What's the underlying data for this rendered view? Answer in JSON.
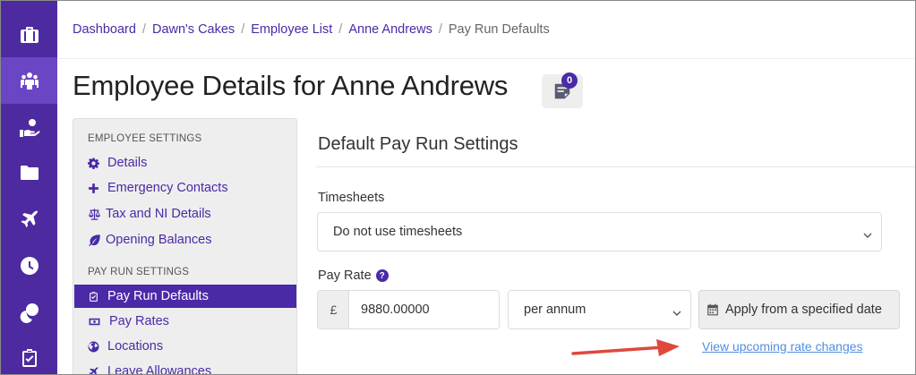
{
  "rail": {
    "items": [
      {
        "icon": "briefcase-icon",
        "active": false
      },
      {
        "icon": "employees-icon",
        "active": true
      },
      {
        "icon": "payments-hand-icon",
        "active": false
      },
      {
        "icon": "folder-icon",
        "active": false
      },
      {
        "icon": "plane-icon",
        "active": false
      },
      {
        "icon": "clock-icon",
        "active": false
      },
      {
        "icon": "coins-icon",
        "active": false
      },
      {
        "icon": "clipboard-check-icon",
        "active": false
      }
    ]
  },
  "breadcrumb": {
    "items": [
      "Dashboard",
      "Dawn's Cakes",
      "Employee List",
      "Anne Andrews"
    ],
    "current": "Pay Run Defaults"
  },
  "page": {
    "title": "Employee Details for Anne Andrews",
    "notes_count": "0"
  },
  "sidemenu": {
    "employee_heading": "EMPLOYEE SETTINGS",
    "employee_items": [
      {
        "label": "Details",
        "icon": "gear-icon"
      },
      {
        "label": "Emergency Contacts",
        "icon": "plus-icon"
      },
      {
        "label": "Tax and NI Details",
        "icon": "balance-scale-icon"
      },
      {
        "label": "Opening Balances",
        "icon": "leaf-icon"
      }
    ],
    "payrun_heading": "PAY RUN SETTINGS",
    "payrun_items": [
      {
        "label": "Pay Run Defaults",
        "icon": "clipboard-list-icon",
        "active": true
      },
      {
        "label": "Pay Rates",
        "icon": "money-bill-icon",
        "active": false
      },
      {
        "label": "Locations",
        "icon": "globe-icon",
        "active": false
      },
      {
        "label": "Leave Allowances",
        "icon": "plane-small-icon",
        "active": false
      }
    ]
  },
  "panel": {
    "title": "Default Pay Run Settings",
    "timesheets_label": "Timesheets",
    "timesheets_value": "Do not use timesheets",
    "pay_rate_label": "Pay Rate",
    "currency_symbol": "£",
    "pay_rate_value": "9880.00000",
    "pay_period_value": "per annum",
    "apply_button": "Apply from a specified date",
    "upcoming_link": "View upcoming rate changes"
  },
  "colors": {
    "brand": "#4e2aa0",
    "accent": "#4a2aa6",
    "link": "#4f8fe0",
    "annotation_arrow": "#e0483c"
  }
}
